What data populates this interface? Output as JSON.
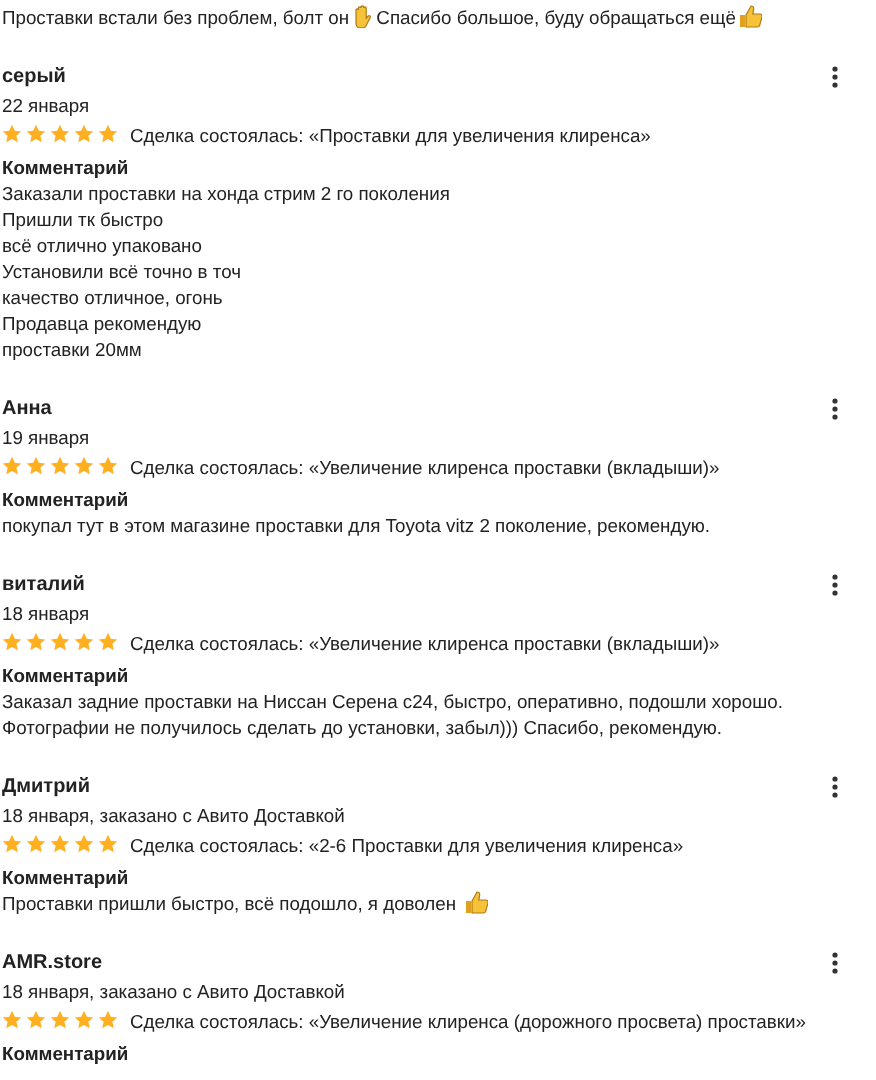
{
  "top_comment": {
    "parts": [
      {
        "kind": "text",
        "text": "Проставки встали без проблем, болт он"
      },
      {
        "kind": "hand"
      },
      {
        "kind": "text",
        "text": " Спасибо большое, буду обращаться ещё"
      },
      {
        "kind": "thumb"
      }
    ]
  },
  "reviews": [
    {
      "author": "серый",
      "date": "22 января",
      "stars": 5,
      "deal": "Сделка состоялась: «Проставки для увеличения клиренса»",
      "comment_label": "Комментарий",
      "lines": [
        [
          {
            "kind": "text",
            "text": "Заказали проставки на хонда стрим 2 го поколения"
          }
        ],
        [
          {
            "kind": "text",
            "text": "Пришли тк быстро"
          }
        ],
        [
          {
            "kind": "text",
            "text": "всё отлично упаковано"
          }
        ],
        [
          {
            "kind": "text",
            "text": "Установили всё точно в точ"
          }
        ],
        [
          {
            "kind": "text",
            "text": "качество отличное, огонь"
          }
        ],
        [
          {
            "kind": "text",
            "text": "Продавца рекомендую"
          }
        ],
        [
          {
            "kind": "text",
            "text": "проставки 20мм"
          }
        ]
      ]
    },
    {
      "author": "Анна",
      "date": "19 января",
      "stars": 5,
      "deal": "Сделка состоялась: «Увеличение клиренса проставки (вкладыши)»",
      "comment_label": "Комментарий",
      "lines": [
        [
          {
            "kind": "text",
            "text": "покупал тут в этом магазине проставки для Toyota vitz 2 поколение, рекомендую."
          }
        ]
      ]
    },
    {
      "author": "виталий",
      "date": "18 января",
      "stars": 5,
      "deal": "Сделка состоялась: «Увеличение клиренса проставки (вкладыши)»",
      "comment_label": "Комментарий",
      "lines": [
        [
          {
            "kind": "text",
            "text": "Заказал задние проставки на Ниссан Серена с24, быстро, оперативно, подошли хорошо."
          }
        ],
        [
          {
            "kind": "text",
            "text": "Фотографии не получилось сделать до установки, забыл))) Спасибо, рекомендую."
          }
        ]
      ]
    },
    {
      "author": "Дмитрий",
      "date": "18 января, заказано с Авито Доставкой",
      "stars": 5,
      "deal": "Сделка состоялась: «2-6 Проставки для увеличения клиренса»",
      "comment_label": "Комментарий",
      "lines": [
        [
          {
            "kind": "text",
            "text": "Проставки пришли быстро, всё подошло, я доволен "
          },
          {
            "kind": "thumb"
          }
        ]
      ]
    },
    {
      "author": "AMR.store",
      "date": "18 января, заказано с Авито Доставкой",
      "stars": 5,
      "deal": "Сделка состоялась: «Увеличение клиренса (дорожного просвета) проставки»",
      "comment_label": "Комментарий"
    }
  ]
}
